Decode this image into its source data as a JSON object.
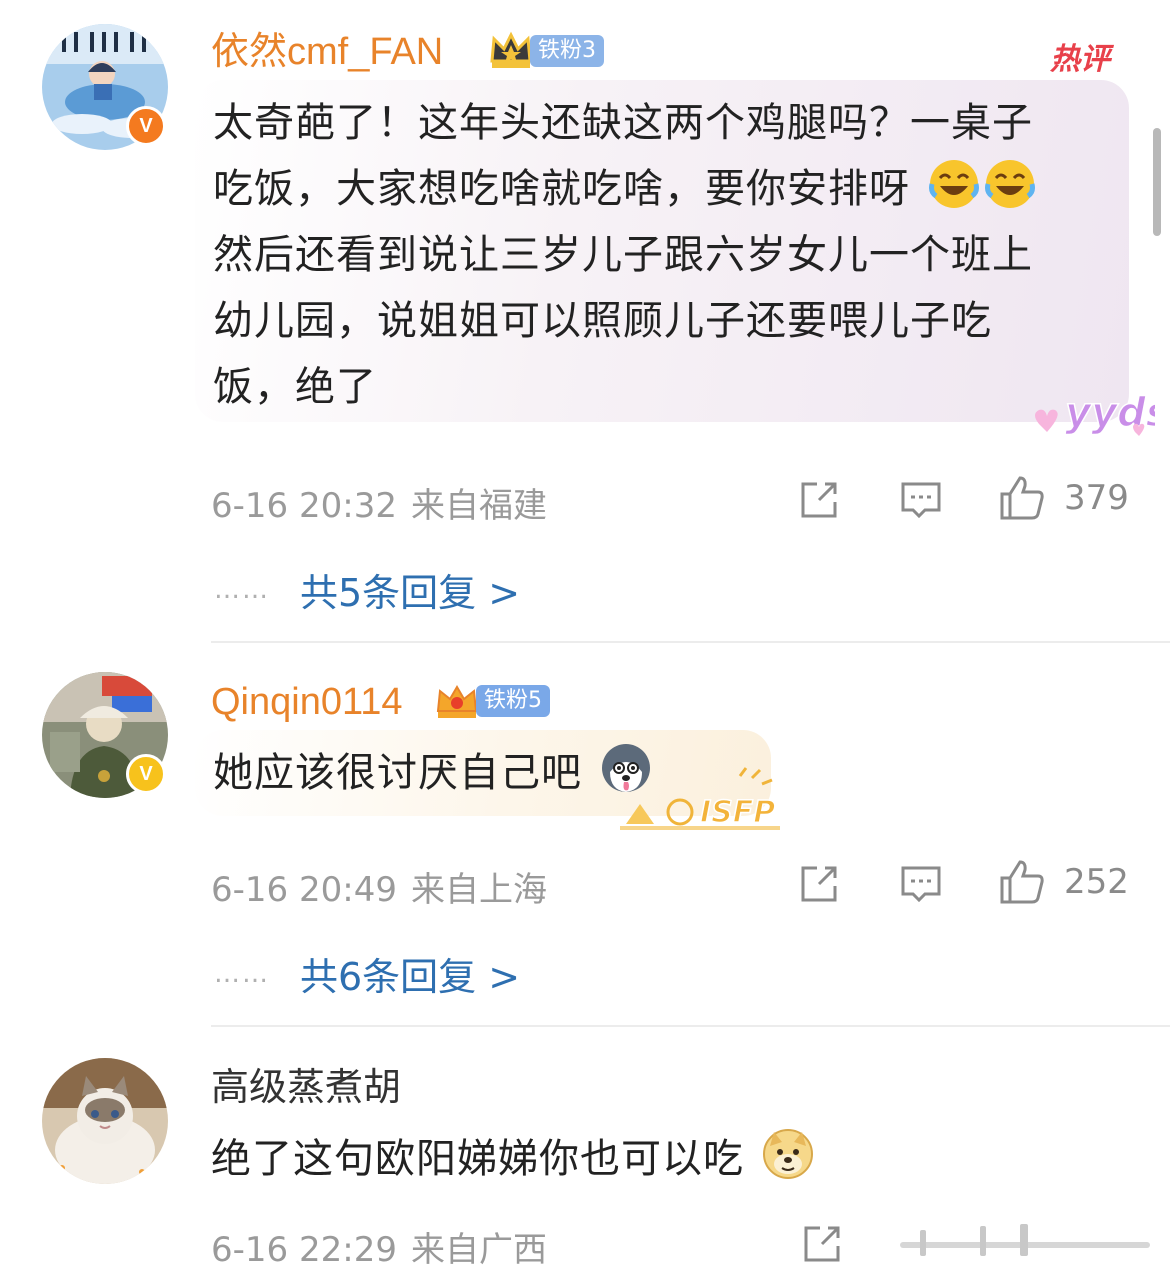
{
  "comments": [
    {
      "username": "依然cmf_FAN",
      "fan_badge": "铁粉3",
      "hot_label": "热评",
      "text_lines": [
        "太奇葩了！这年头还缺这两个鸡腿吗？一桌子",
        "吃饭，大家想吃啥就吃啥，要你安排呀",
        "然后还看到说让三岁儿子跟六岁女儿一个班上",
        "幼儿园，说姐姐可以照顾儿子还要喂儿子吃",
        "饭，绝了"
      ],
      "emojis": [
        "laughing-crying-emoji",
        "laughing-crying-emoji"
      ],
      "sticker": "yyds",
      "date": "6-16 20:32",
      "location": "来自福建",
      "likes": "379",
      "replies": "共5条回复 >",
      "verified": "V"
    },
    {
      "username": "Qinqin0114",
      "fan_badge": "铁粉5",
      "text": "她应该很讨厌自己吧",
      "emojis": [
        "husky-emoji"
      ],
      "sticker": "ISFP",
      "date": "6-16 20:49",
      "location": "来自上海",
      "likes": "252",
      "replies": "共6条回复 >",
      "verified": "V"
    },
    {
      "username": "高级蒸煮胡",
      "text": "绝了这句欧阳娣娣你也可以吃",
      "emojis": [
        "doge-emoji"
      ],
      "date": "6-16 22:29",
      "location": "来自广西"
    }
  ],
  "reply_dots": "……",
  "colors": {
    "fan_name": "#e8832a",
    "reply_link": "#2e6fb0",
    "meta_gray": "#9a9a9a",
    "hot_red": "#e8404a",
    "fan_tag": "#8cb4e8"
  }
}
